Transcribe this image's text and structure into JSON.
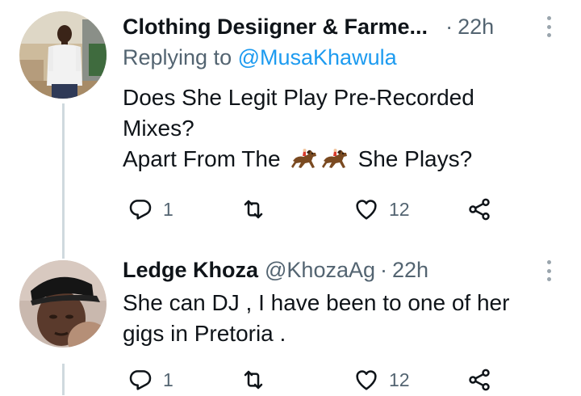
{
  "tweets": [
    {
      "name": "Clothing Desiigner & Farme...",
      "handle": "",
      "time": "22h",
      "replying_prefix": "Replying to ",
      "replying_to": "@MusaKhawula",
      "lines": [
        "Does She Legit Play Pre-Recorded",
        "Mixes?"
      ],
      "line3_before": "Apart From The",
      "line3_emoji": [
        "horse-racing-emoji",
        "horse-racing-emoji"
      ],
      "line3_after": "She Plays?",
      "reply_count": "1",
      "retweet_count": "",
      "like_count": "12",
      "avatar": "user-photo-white-shirt"
    },
    {
      "name": "Ledge Khoza",
      "handle": "@KhozaAg",
      "time": "22h",
      "lines": [
        "She can DJ , I have been to one of her",
        "gigs in Pretoria ."
      ],
      "reply_count": "1",
      "retweet_count": "",
      "like_count": "12",
      "avatar": "user-photo-black-cap"
    }
  ],
  "icons": {
    "reply": "reply-icon",
    "retweet": "retweet-icon",
    "like": "heart-icon",
    "share": "share-icon",
    "more": "more-options-icon"
  },
  "colors": {
    "text": "#0f1419",
    "secondary": "#536471",
    "link": "#1d9bf0",
    "thread_line": "#cfd9de"
  }
}
